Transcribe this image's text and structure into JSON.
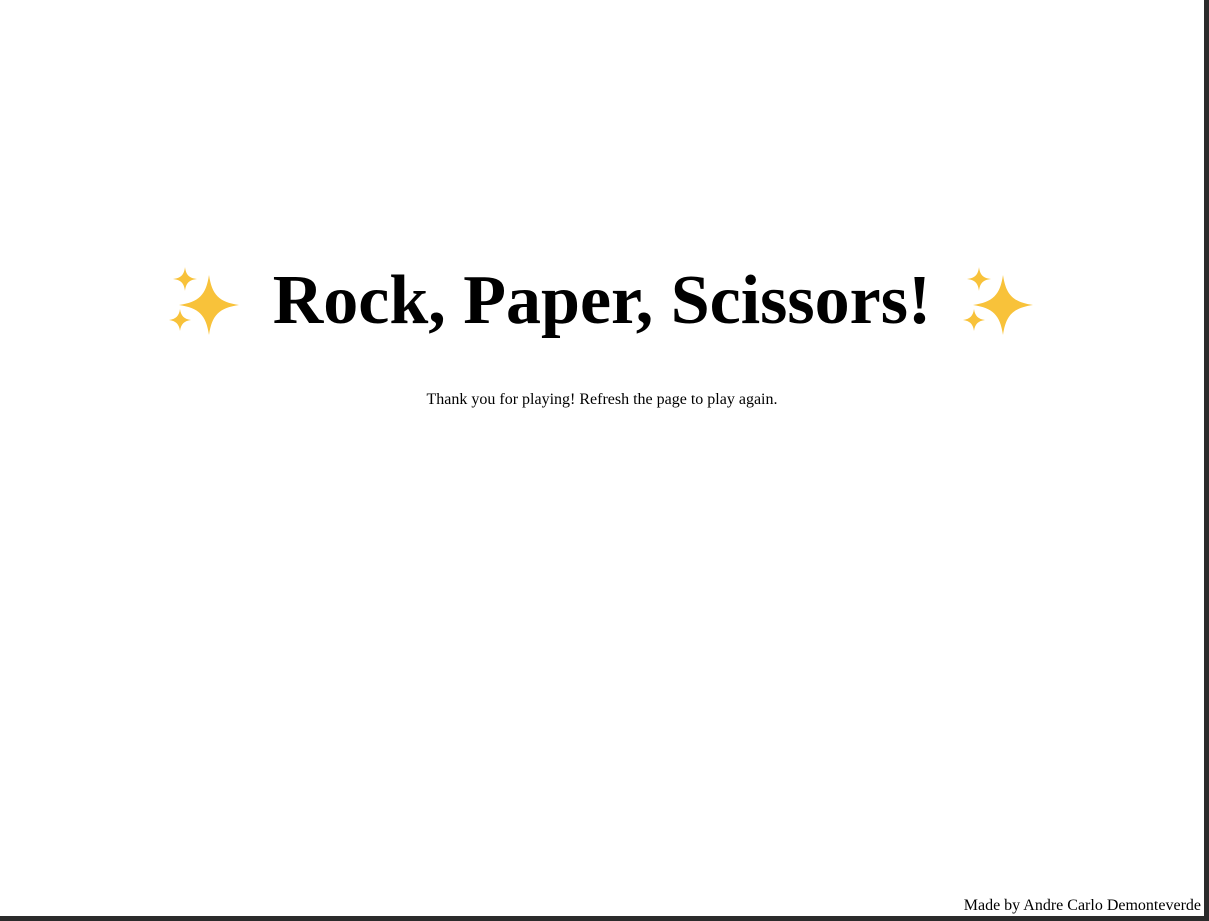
{
  "title": {
    "left_icon": "sparkles-icon",
    "text": "Rock, Paper, Scissors!",
    "right_icon": "sparkles-icon"
  },
  "message": "Thank you for playing! Refresh the page to play again.",
  "footer": {
    "credit": "Made by Andre Carlo Demonteverde"
  },
  "colors": {
    "sparkle": "#F8C23A",
    "text": "#000000",
    "background": "#FFFFFF",
    "frame": "#2B2B2B"
  }
}
